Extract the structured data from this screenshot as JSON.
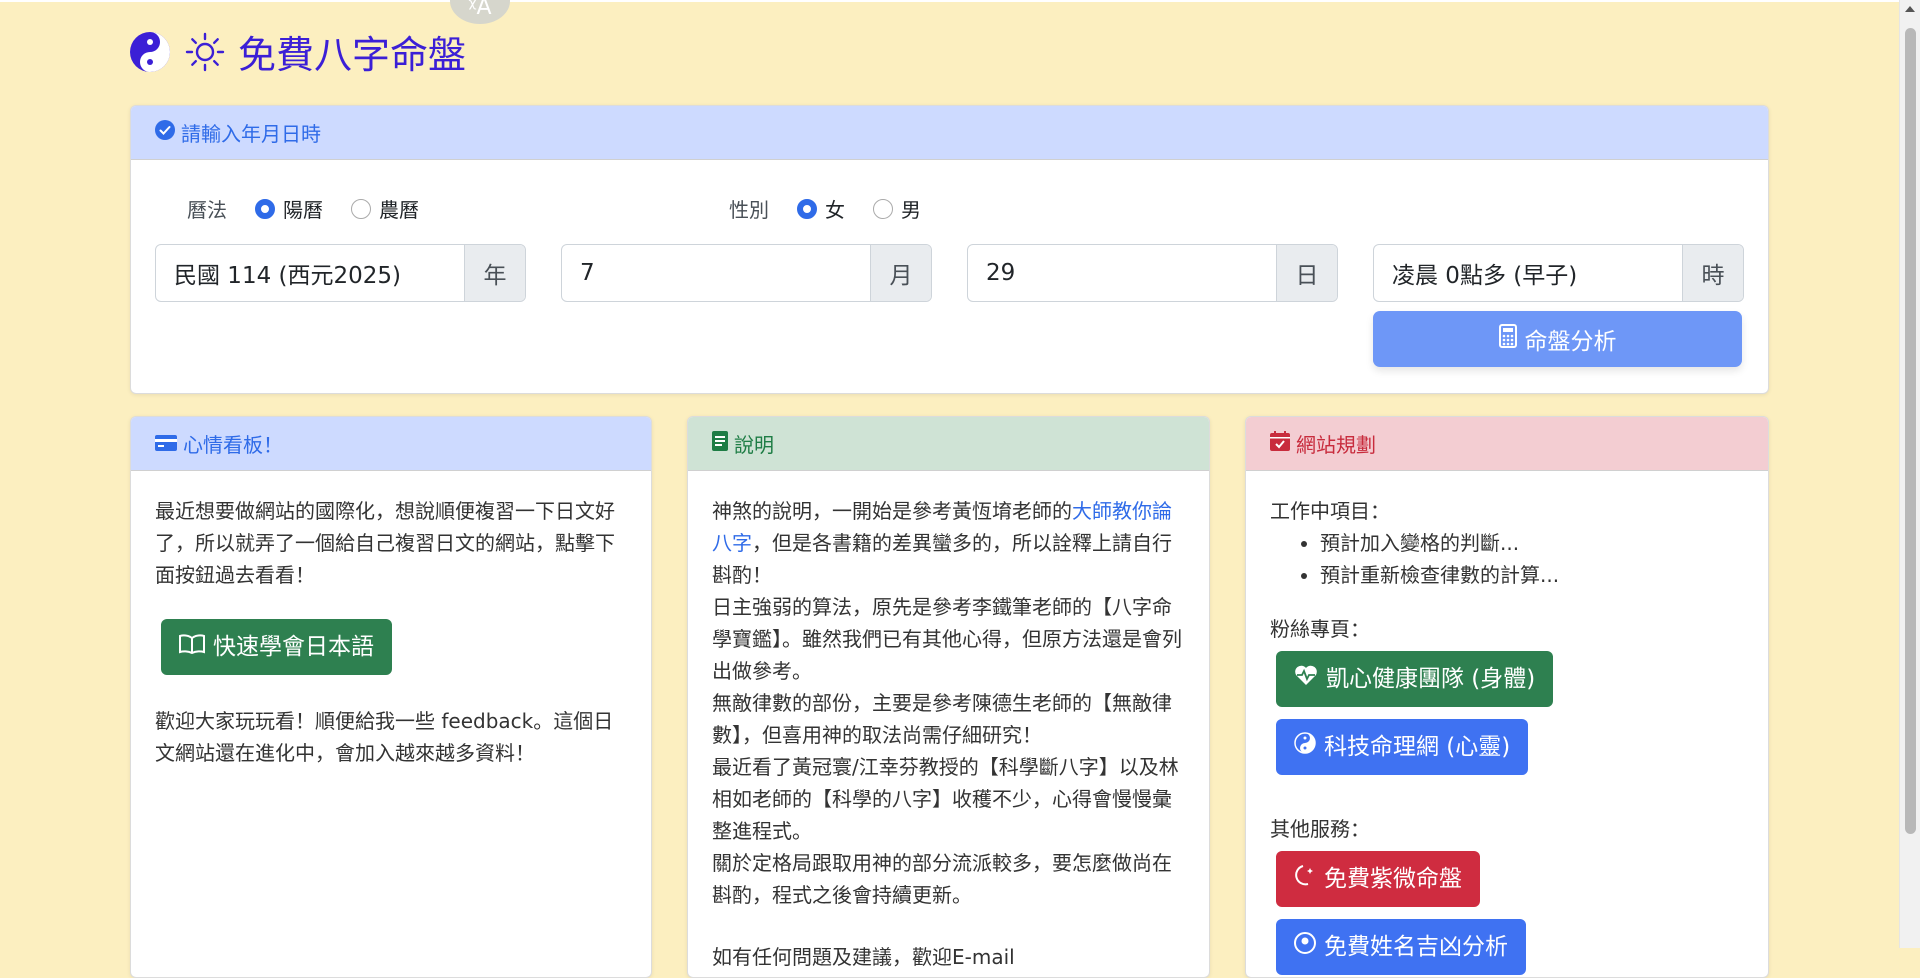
{
  "page": {
    "title": "免費八字命盤",
    "translate_badge": "ᵡA"
  },
  "input_card": {
    "header": "請輸入年月日時",
    "calendar_label": "曆法",
    "calendar_options": [
      "陽曆",
      "農曆"
    ],
    "calendar_selected": "陽曆",
    "gender_label": "性別",
    "gender_options": [
      "女",
      "男"
    ],
    "gender_selected": "女",
    "year_value": "民國 114 (西元2025)",
    "year_suffix": "年",
    "month_value": "7",
    "month_suffix": "月",
    "day_value": "29",
    "day_suffix": "日",
    "hour_value": "凌晨 0點多 (早子)",
    "hour_suffix": "時",
    "analyze_button": "命盤分析"
  },
  "mood_card": {
    "header": "心情看板！",
    "text1": "最近想要做網站的國際化，想說順便複習一下日文好了，所以就弄了一個給自己複習日文的網站，點擊下面按鈕過去看看！",
    "button": "快速學會日本語",
    "text2": "歡迎大家玩玩看！順便給我一些 feedback。這個日文網站還在進化中，會加入越來越多資料！"
  },
  "info_card": {
    "header": "說明",
    "p1_before": "神煞的說明，一開始是參考黃恆堉老師的",
    "p1_link": "大師教你論八字",
    "p1_after": "，但是各書籍的差異蠻多的，所以詮釋上請自行斟酌！",
    "p2": "日主強弱的算法，原先是參考李鐵筆老師的【八字命學寶鑑】。雖然我們已有其他心得，但原方法還是會列出做參考。",
    "p3": "無敵律數的部份，主要是參考陳德生老師的【無敵律數】，但喜用神的取法尚需仔細研究！",
    "p4": "最近看了黃冠寰/江幸芬教授的【科學斷八字】以及林相如老師的【科學的八字】收穫不少，心得會慢慢彙整進程式。",
    "p5": "關於定格局跟取用神的部分流派較多，要怎麼做尚在斟酌，程式之後會持續更新。",
    "p6_partial": "如有任何問題及建議，歡迎E-mail"
  },
  "plan_card": {
    "header": "網站規劃",
    "work_label": "工作中項目：",
    "work_items": [
      "預計加入變格的判斷...",
      "預計重新檢查律數的計算..."
    ],
    "fans_label": "粉絲專頁：",
    "fan_button_1": "凱心健康團隊 (身體)",
    "fan_button_2": "科技命理網 (心靈)",
    "other_label": "其他服務：",
    "service_button_1": "免費紫微命盤",
    "service_button_2": "免費姓名吉凶分析"
  },
  "colors": {
    "background": "#fcefc0",
    "title": "#3b1fd6",
    "primary": "#2f6be8",
    "success": "#2e8050",
    "danger": "#cf2c40"
  }
}
